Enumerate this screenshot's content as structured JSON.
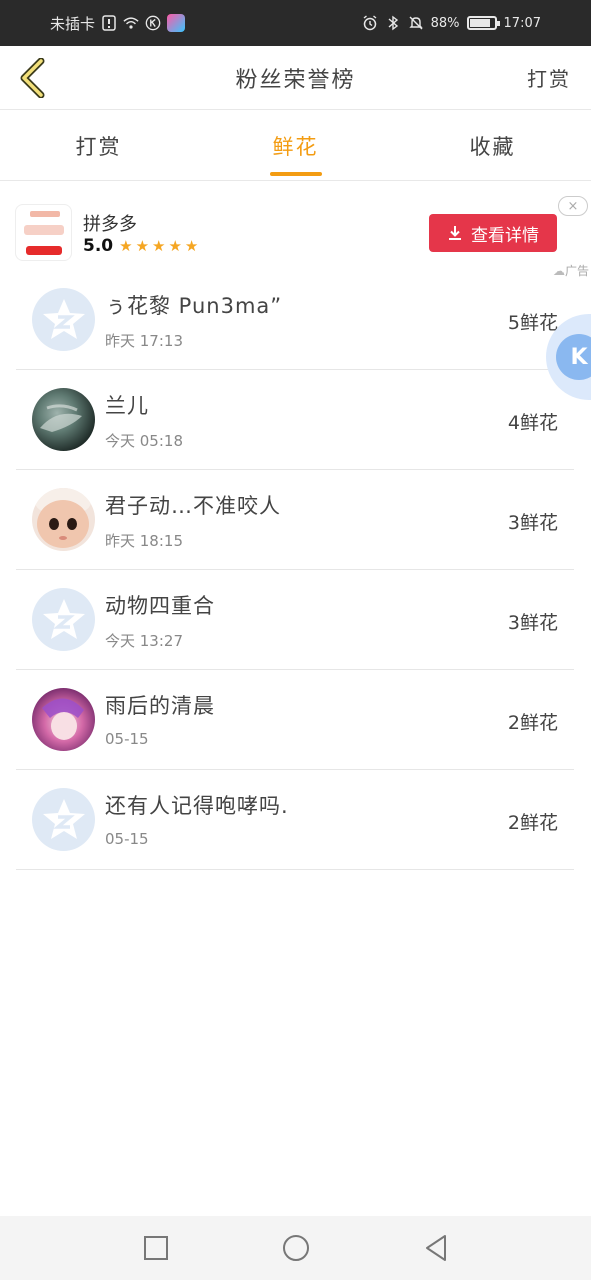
{
  "status_bar": {
    "carrier": "未插卡",
    "battery": "88%",
    "battery_level": 0.88,
    "time": "17:07"
  },
  "header": {
    "title": "粉丝荣誉榜",
    "right_action": "打赏"
  },
  "tabs": [
    {
      "label": "打赏",
      "active": false
    },
    {
      "label": "鲜花",
      "active": true
    },
    {
      "label": "收藏",
      "active": false
    }
  ],
  "ad": {
    "app_name": "拼多多",
    "rating": "5.0",
    "stars": "★★★★★",
    "button_label": "查看详情",
    "close": "×",
    "tag": "广告"
  },
  "fans": [
    {
      "nickname": "ぅ花黎 Pun3ma”",
      "time": "昨天 17:13",
      "count": "5鲜花",
      "avatar": "default"
    },
    {
      "nickname": "兰儿",
      "time": "今天 05:18",
      "count": "4鲜花",
      "avatar": "photo-dark"
    },
    {
      "nickname": "君子动…不准咬人",
      "time": "昨天 18:15",
      "count": "3鲜花",
      "avatar": "photo-doll"
    },
    {
      "nickname": "动物四重合",
      "time": "今天 13:27",
      "count": "3鲜花",
      "avatar": "default"
    },
    {
      "nickname": "雨后的清晨",
      "time": "05-15",
      "count": "2鲜花",
      "avatar": "photo-anime"
    },
    {
      "nickname": "还有人记得咆哮吗.",
      "time": "05-15",
      "count": "2鲜花",
      "avatar": "default"
    }
  ],
  "float_button": {
    "label": "K"
  },
  "colors": {
    "accent": "#f39c12",
    "ad_button": "#e5364a",
    "default_avatar": "#dfe9f5"
  }
}
